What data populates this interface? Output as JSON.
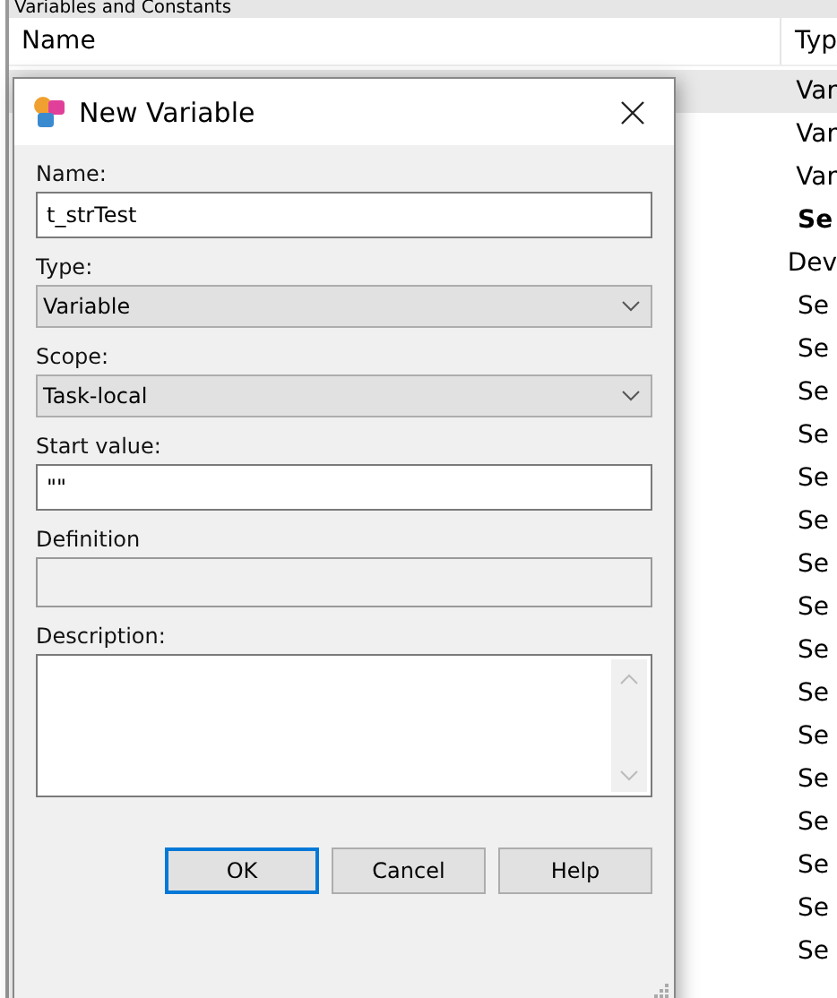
{
  "panel": {
    "title": "Variables and Constants",
    "columns": [
      "Name",
      "Typ"
    ],
    "rows": [
      {
        "column_2": "Var",
        "selected": true,
        "bold": false
      },
      {
        "column_2": "Var",
        "selected": false,
        "bold": false
      },
      {
        "column_2": "Var",
        "selected": false,
        "bold": false
      },
      {
        "column_2": "Se",
        "selected": false,
        "bold": true
      },
      {
        "column_2": "Dev",
        "selected": false,
        "bold": false
      },
      {
        "column_2": "Se",
        "selected": false,
        "bold": false
      },
      {
        "column_2": "Se",
        "selected": false,
        "bold": false
      },
      {
        "column_2": "Se",
        "selected": false,
        "bold": false
      },
      {
        "column_2": "Se",
        "selected": false,
        "bold": false
      },
      {
        "column_2": "Se",
        "selected": false,
        "bold": false
      },
      {
        "column_2": "Se",
        "selected": false,
        "bold": false
      },
      {
        "column_2": "Se",
        "selected": false,
        "bold": false
      },
      {
        "column_2": "Se",
        "selected": false,
        "bold": false
      },
      {
        "column_2": "Se",
        "selected": false,
        "bold": false
      },
      {
        "column_2": "Se",
        "selected": false,
        "bold": false
      },
      {
        "column_2": "Se",
        "selected": false,
        "bold": false
      },
      {
        "column_2": "Se",
        "selected": false,
        "bold": false
      },
      {
        "column_2": "Se",
        "selected": false,
        "bold": false
      },
      {
        "column_2": "Se",
        "selected": false,
        "bold": false
      },
      {
        "column_2": "Se",
        "selected": false,
        "bold": false
      },
      {
        "column_2": "Se",
        "selected": false,
        "bold": false
      }
    ]
  },
  "dialog": {
    "title": "New Variable",
    "fields": [
      {
        "kind": "text",
        "label": "Name:",
        "value": "t_strTest"
      },
      {
        "kind": "select",
        "label": "Type:",
        "value": "Variable"
      },
      {
        "kind": "select",
        "label": "Scope:",
        "value": "Task-local"
      },
      {
        "kind": "text",
        "label": "Start value:",
        "value": "\"\""
      },
      {
        "kind": "disabled",
        "label": "Definition"
      },
      {
        "kind": "textarea",
        "label": "Description:"
      }
    ],
    "buttons": [
      {
        "label": "OK",
        "default": true
      },
      {
        "label": "Cancel",
        "default": false
      },
      {
        "label": "Help",
        "default": false
      }
    ]
  }
}
